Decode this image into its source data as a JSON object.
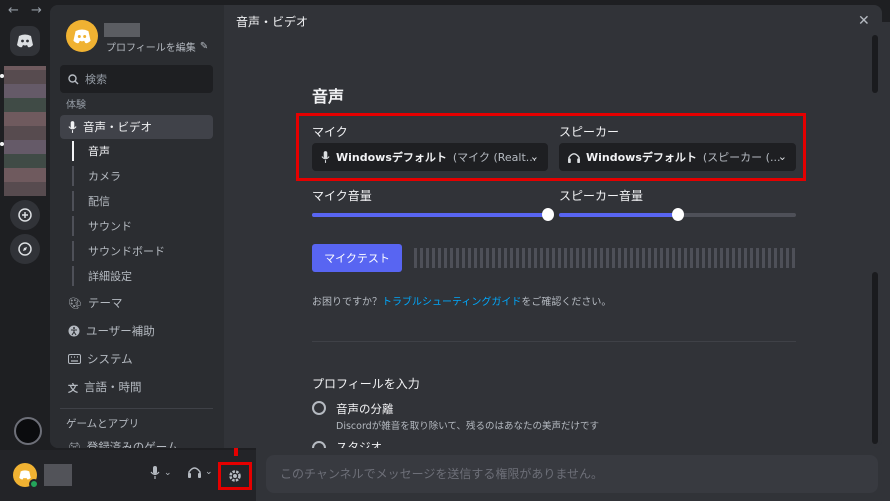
{
  "window": {
    "nav_arrows": "← →"
  },
  "sidebar": {
    "profile_edit": "プロフィールを編集",
    "search_placeholder": "検索",
    "section_experience": "体験",
    "items": [
      {
        "label": "音声・ビデオ"
      },
      {
        "label": "テーマ"
      },
      {
        "label": "ユーザー補助"
      },
      {
        "label": "システム"
      },
      {
        "label": "言語・時間"
      }
    ],
    "sub_items": [
      "音声",
      "カメラ",
      "配信",
      "サウンド",
      "サウンドボード",
      "詳細設定"
    ],
    "section_games": "ゲームとアプリ",
    "partial_item": "登録済みのゲーム"
  },
  "main": {
    "header": "音声・ビデオ",
    "section_title": "音声",
    "mic_label": "マイク",
    "mic_value_bold": "Windowsデフォルト",
    "mic_value_rest": "(マイク (Realt...",
    "speaker_label": "スピーカー",
    "speaker_value_bold": "Windowsデフォルト",
    "speaker_value_rest": "(スピーカー (...",
    "mic_volume_label": "マイク音量",
    "speaker_volume_label": "スピーカー音量",
    "mic_volume": 1.0,
    "speaker_volume": 0.5,
    "mic_test_button": "マイクテスト",
    "help_prefix": "お困りですか？",
    "help_link": "トラブルシューティングガイド",
    "help_suffix": "をご確認ください。",
    "profile_title": "プロフィールを入力",
    "option1_label": "音声の分離",
    "option1_desc": "Discordが雑音を取り除いて、残るのはあなたの美声だけです",
    "option2_label": "スタジオ"
  },
  "chat": {
    "message_placeholder": "このチャンネルでメッセージを送信する権限がありません。"
  },
  "colors": {
    "accent": "#5865f2",
    "highlight_red": "#e50000",
    "link": "#00a8fc",
    "online": "#23a55a"
  }
}
